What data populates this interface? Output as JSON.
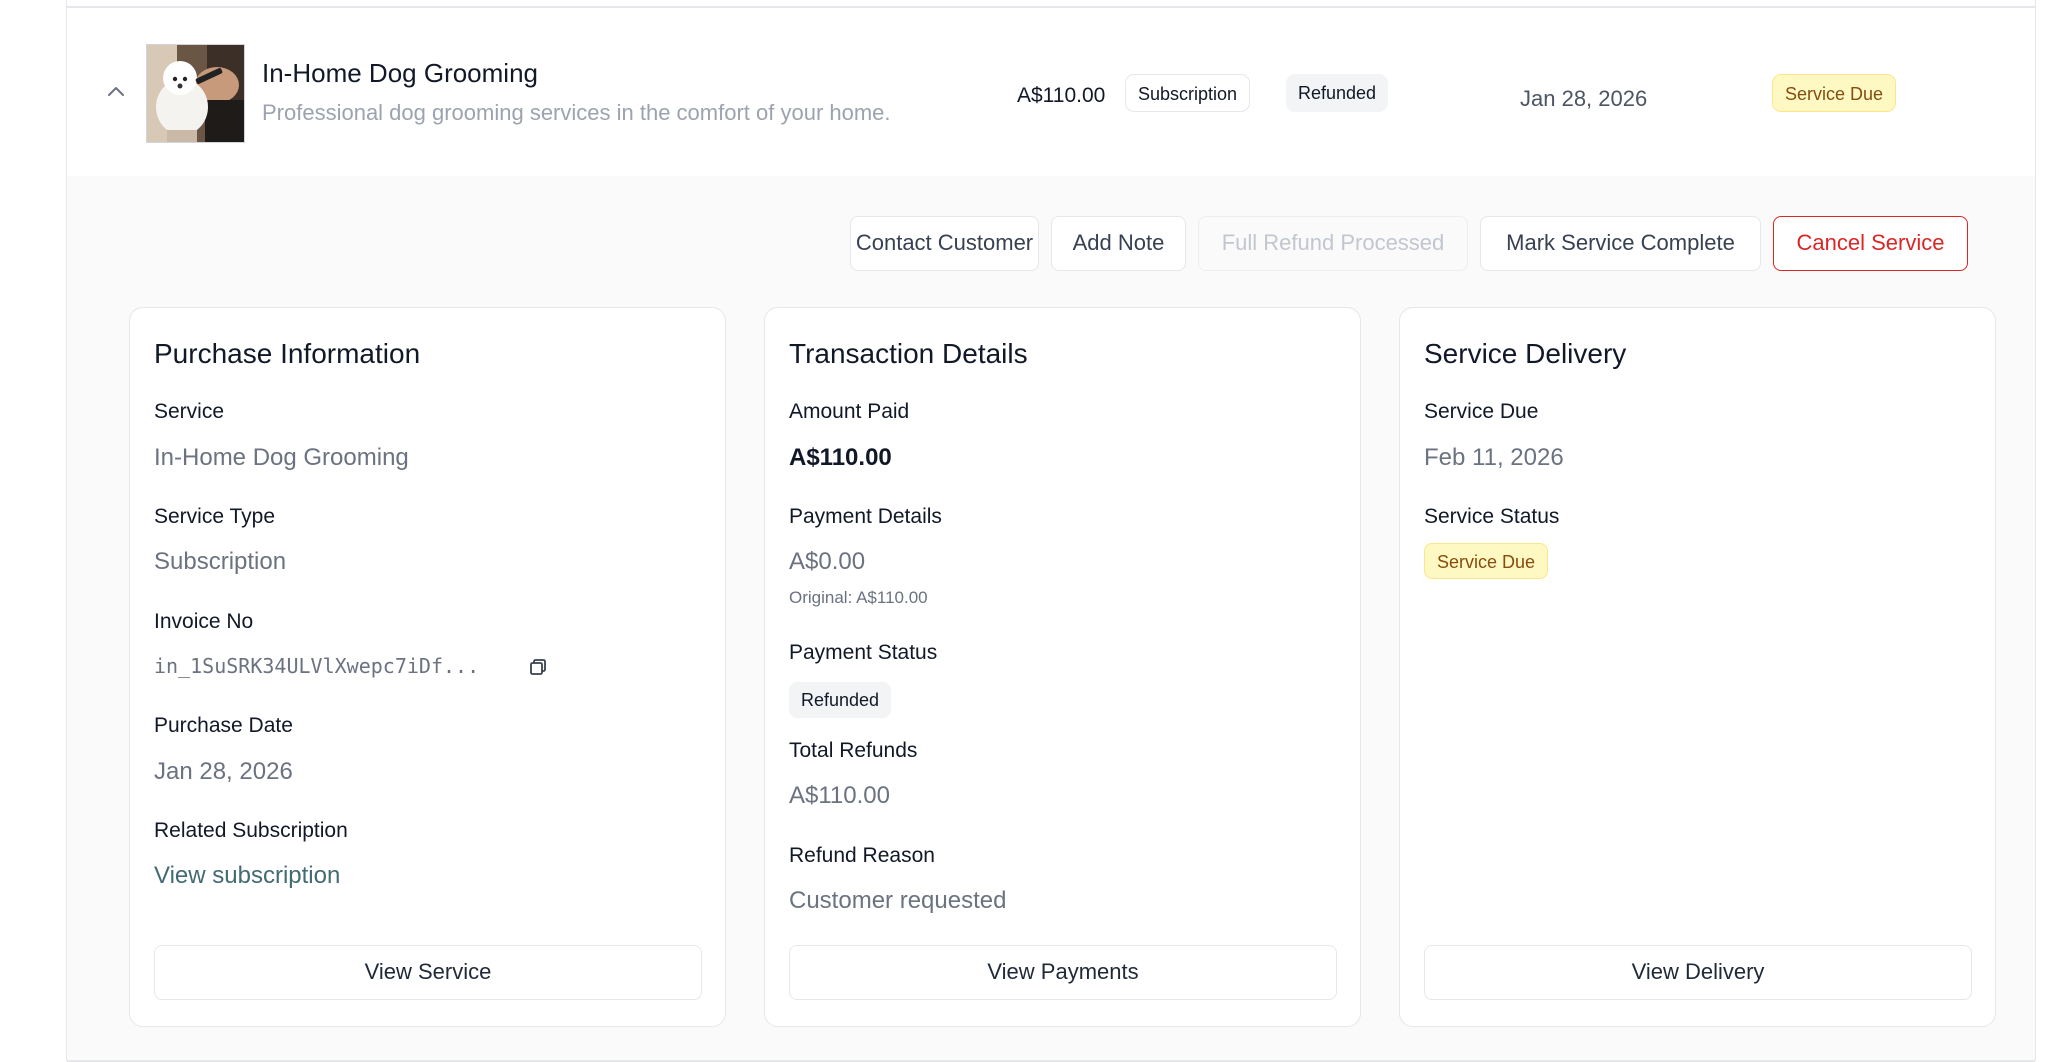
{
  "service_row": {
    "title": "In-Home Dog Grooming",
    "description": "Professional dog grooming services in the comfort of your home.",
    "price": "A$110.00",
    "type_badge": "Subscription",
    "payment_badge": "Refunded",
    "date": "Jan 28, 2026",
    "status_badge": "Service Due"
  },
  "actions": {
    "contact": "Contact Customer",
    "add_note": "Add Note",
    "refund": "Full Refund Processed",
    "complete": "Mark Service Complete",
    "cancel": "Cancel Service"
  },
  "purchase": {
    "title": "Purchase Information",
    "service_label": "Service",
    "service_value": "In-Home Dog Grooming",
    "type_label": "Service Type",
    "type_value": "Subscription",
    "invoice_label": "Invoice No",
    "invoice_value": "in_1SuSRK34ULVlXwepc7iDf...",
    "date_label": "Purchase Date",
    "date_value": "Jan 28, 2026",
    "subscription_label": "Related Subscription",
    "subscription_link": "View subscription",
    "button": "View Service"
  },
  "transaction": {
    "title": "Transaction Details",
    "amount_label": "Amount Paid",
    "amount_value": "A$110.00",
    "payment_label": "Payment Details",
    "payment_value": "A$0.00",
    "payment_original": "Original: A$110.00",
    "status_label": "Payment Status",
    "status_value": "Refunded",
    "refunds_label": "Total Refunds",
    "refunds_value": "A$110.00",
    "reason_label": "Refund Reason",
    "reason_value": "Customer requested",
    "button": "View Payments"
  },
  "delivery": {
    "title": "Service Delivery",
    "due_label": "Service Due",
    "due_value": "Feb 11, 2026",
    "status_label": "Service Status",
    "status_value": "Service Due",
    "button": "View Delivery"
  },
  "icons": {
    "expand": "chevron-up-icon",
    "copy": "copy-icon"
  },
  "colors": {
    "danger": "#dc2626",
    "due_bg": "#fef9c3",
    "due_text": "#854d0e",
    "link": "#436b72"
  }
}
